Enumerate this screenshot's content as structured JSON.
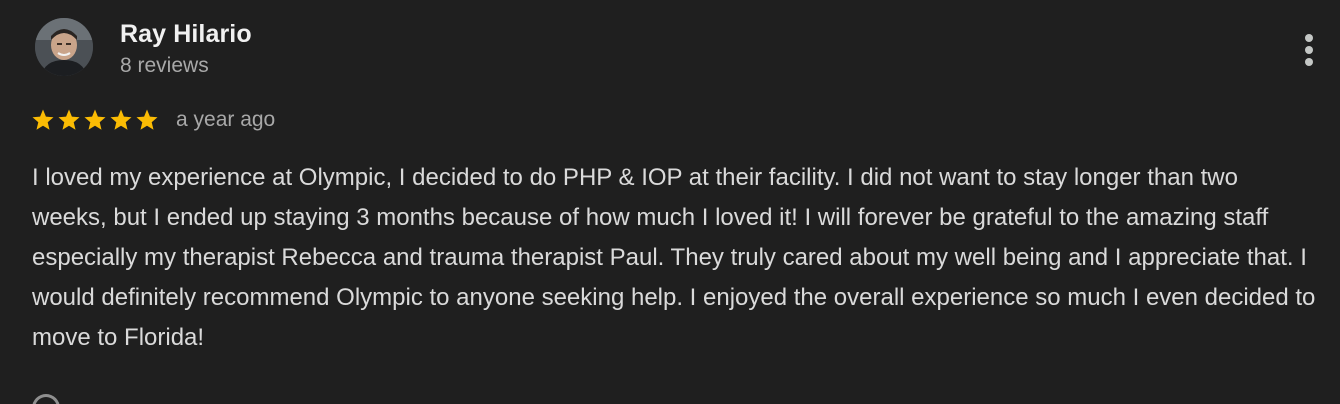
{
  "review": {
    "author": {
      "name": "Ray Hilario",
      "review_count": "8 reviews",
      "avatar_icon": "profile-photo"
    },
    "rating": {
      "stars": 5,
      "max_stars": 5,
      "star_color": "#fbbc04"
    },
    "time_ago": "a year ago",
    "text": "I loved my experience at Olympic, I decided to do PHP & IOP at their facility. I did not want to stay longer than two weeks, but I ended up staying 3 months because of how much I loved it! I will forever be grateful to the amazing staff especially my therapist Rebecca and trauma therapist Paul. They truly cared about my well being and I appreciate that. I would definitely recommend Olympic to anyone seeking help. I enjoyed the overall experience so much I even decided to move to Florida!",
    "menu_icon": "more-vertical-icon",
    "footer_icon": "like-icon"
  },
  "theme": {
    "background": "#1f1f1f",
    "primary_text": "#f1f1f1",
    "secondary_text": "#a8a8a8"
  }
}
